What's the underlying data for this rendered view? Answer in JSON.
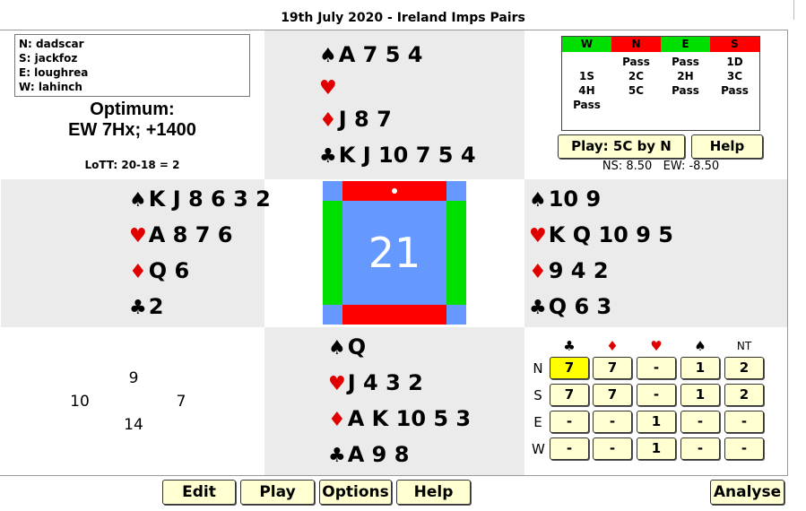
{
  "title": "19th July 2020 - Ireland Imps Pairs",
  "players": {
    "north": "N: dadscar",
    "south": "S: jackfoz",
    "east": "E: loughrea",
    "west": "W: lahinch"
  },
  "optimum": {
    "label": "Optimum:",
    "value": "EW 7Hx; +1400",
    "lott": "LoTT: 20-18 = 2"
  },
  "hands": {
    "north": {
      "spades": "A 7 5 4",
      "hearts": "",
      "diamonds": "J 8 7",
      "clubs": "K J 10 7 5 4"
    },
    "west": {
      "spades": "K J 8 6 3 2",
      "hearts": "A 8 7 6",
      "diamonds": "Q 6",
      "clubs": "2"
    },
    "east": {
      "spades": "10 9",
      "hearts": "K Q 10 9 5",
      "diamonds": "9 4 2",
      "clubs": "Q 6 3"
    },
    "south": {
      "spades": "Q",
      "hearts": "J 4 3 2",
      "diamonds": "A K 10 5 3",
      "clubs": "A 9 8"
    }
  },
  "suit_symbols": {
    "spades": "♠",
    "hearts": "♥",
    "diamonds": "♦",
    "clubs": "♣"
  },
  "board": {
    "number": "21",
    "ns_color": "#ff0000",
    "ew_color": "#00e000",
    "center_color": "#6699ff"
  },
  "bidding": {
    "headers": [
      "W",
      "N",
      "E",
      "S"
    ],
    "header_colors": [
      "#00e000",
      "#ff0000",
      "#00e000",
      "#ff0000"
    ],
    "rows": [
      [
        "",
        "Pass",
        "Pass",
        "1D"
      ],
      [
        "1S",
        "2C",
        "2H",
        "3C"
      ],
      [
        "4H",
        "5C",
        "Pass",
        "Pass"
      ],
      [
        "Pass",
        "",
        "",
        ""
      ]
    ]
  },
  "play_button": "Play: 5C by N",
  "help_button_top": "Help",
  "scores": "NS: 8.50   EW: -8.50",
  "hcp": {
    "north": "9",
    "west": "10",
    "east": "7",
    "south": "14"
  },
  "dd_table": {
    "suit_headers": [
      "♣",
      "♦",
      "♥",
      "♠",
      "NT"
    ],
    "rows": [
      {
        "seat": "N",
        "values": [
          "7",
          "7",
          "-",
          "1",
          "2"
        ]
      },
      {
        "seat": "S",
        "values": [
          "7",
          "7",
          "-",
          "1",
          "2"
        ]
      },
      {
        "seat": "E",
        "values": [
          "-",
          "-",
          "1",
          "-",
          "-"
        ]
      },
      {
        "seat": "W",
        "values": [
          "-",
          "-",
          "1",
          "-",
          "-"
        ]
      }
    ],
    "highlight_color": "#ffff00"
  },
  "bottom_buttons": {
    "edit": "Edit",
    "play": "Play",
    "options": "Options",
    "help": "Help",
    "analyse": "Analyse"
  }
}
